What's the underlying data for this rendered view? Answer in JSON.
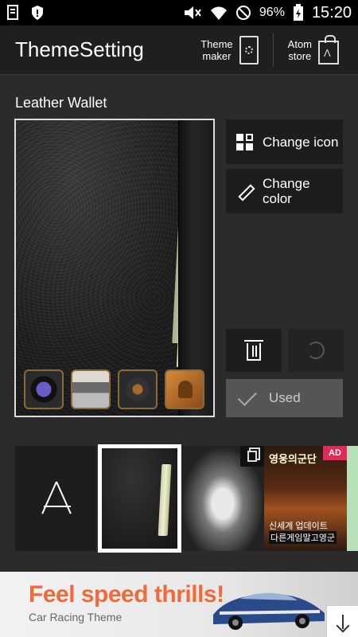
{
  "status_bar": {
    "battery_percent": "96%",
    "time": "15:20",
    "icons": [
      "sim-icon",
      "shield-icon",
      "mute-icon",
      "wifi-icon",
      "blocked-icon",
      "battery-charging-icon"
    ]
  },
  "header": {
    "title": "ThemeSetting",
    "theme_maker_label": "Theme\nmaker",
    "atom_store_label": "Atom\nstore"
  },
  "theme": {
    "name": "Leather Wallet"
  },
  "actions": {
    "change_icon": "Change icon",
    "change_color": "Change\ncolor",
    "used": "Used"
  },
  "thumbnails": {
    "game_title": "영웅의군단",
    "game_line1": "신세계 업데이트",
    "game_line2": "다른게임말고영군",
    "ad_badge": "AD"
  },
  "banner": {
    "headline": "Feel speed thrills!",
    "subtitle": "Car Racing Theme",
    "accent_color": "#f06a3a"
  }
}
